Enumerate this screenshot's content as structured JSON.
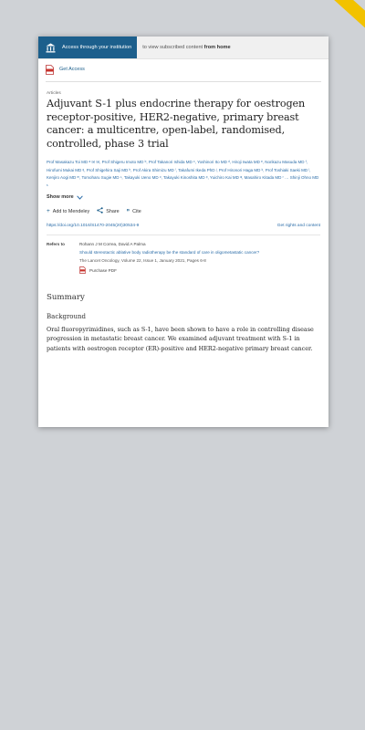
{
  "access_bar": {
    "institution_button": "Access through your institution",
    "note_prefix": "to view subscribed content ",
    "note_emphasis": "from home"
  },
  "get_access": "Get Access",
  "article": {
    "type": "Articles",
    "title": "Adjuvant S-1 plus endocrine therapy for oestrogen receptor-positive, HER2-negative, primary breast cancer: a multicentre, open-label, randomised, controlled, phase 3 trial",
    "authors": "Prof Masakazu Toi MD ᵃ ✉ ✉, Prof Shigeru Imoto MD ᵇ, Prof Takanori Ishida MD ᶜ, Yoshinori Ito MD ᵈ, Hiroji Iwata MD ᵉ, Norikazu Masuda MD ᶠ, Hirofumi Mukai MD ᵍ, Prof Shigehira Saji MD ʰ, Prof Akira Shimizu MD ⁱ, Takafumi Ikeda PhD ʲ, Prof Hironori Haga MD ᵏ, Prof Toshiaki Saeki MD ˡ, Kenjiro Aogi MD ᵐ, Tomoharu Sugie MD ⁿ, Takayuki Ueno MD ᵒ, Takayuki Kinoshita MD ᵖ, Yuichiro Kai MD ᵠ, Masahiro Kitada MD ʳ … Shinji Ohno MD ˢ",
    "show_more": "Show more",
    "actions": {
      "mendeley": "Add to Mendeley",
      "share": "Share",
      "cite": "Cite"
    },
    "doi": "https://doi.org/10.1016/S1470-2045(20)30534-9",
    "rights": "Get rights and content",
    "refers_to": {
      "label": "Refers to",
      "authors": "Rohann J M Correa, David A Palma",
      "title": "Should stereotactic ablative body radiotherapy be the standard of care in oligometastatic cancer?",
      "journal": "The Lancet Oncology, Volume 22, Issue 1, January 2021, Pages 6-8",
      "purchase": "Purchase PDF"
    },
    "summary_heading": "Summary",
    "background_heading": "Background",
    "background_text": "Oral fluoropyrimidines, such as S-1, have been shown to have a role in controlling disease progression in metastatic breast cancer. We examined adjuvant treatment with S-1 in patients with oestrogen receptor (ER)-positive and HER2-negative primary breast cancer."
  },
  "colors": {
    "background": "#cfd2d6",
    "institution_blue": "#1c5f8c",
    "link_blue": "#2a6ca8",
    "ribbon_yellow": "#f2c200"
  },
  "icons": {
    "institution": "institution-icon",
    "pdf": "pdf-icon",
    "chevron": "chevron-down-icon",
    "add": "plus-icon",
    "share": "share-icon",
    "cite": "quote-icon"
  }
}
